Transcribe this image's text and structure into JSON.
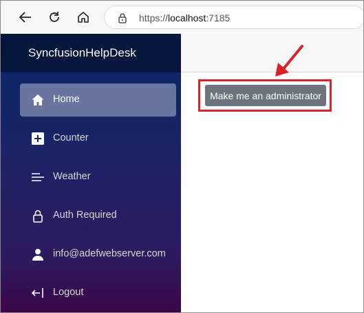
{
  "browser": {
    "url_scheme": "https://",
    "url_host": "localhost",
    "url_port": ":7185"
  },
  "app": {
    "brand": "SyncfusionHelpDesk"
  },
  "sidebar": {
    "items": [
      {
        "label": "Home",
        "icon": "home-icon",
        "active": true
      },
      {
        "label": "Counter",
        "icon": "plus-square-icon",
        "active": false
      },
      {
        "label": "Weather",
        "icon": "list-lines-icon",
        "active": false
      },
      {
        "label": "Auth Required",
        "icon": "lock-icon",
        "active": false
      },
      {
        "label": "info@adefwebserver.com",
        "icon": "person-icon",
        "active": false
      },
      {
        "label": "Logout",
        "icon": "logout-arrow-icon",
        "active": false
      }
    ]
  },
  "main": {
    "admin_button_label": "Make me an administrator"
  },
  "colors": {
    "annotation": "#d9222a",
    "button": "#6c757d",
    "sidebar_top": "#052767",
    "sidebar_bottom": "#3a0647"
  }
}
